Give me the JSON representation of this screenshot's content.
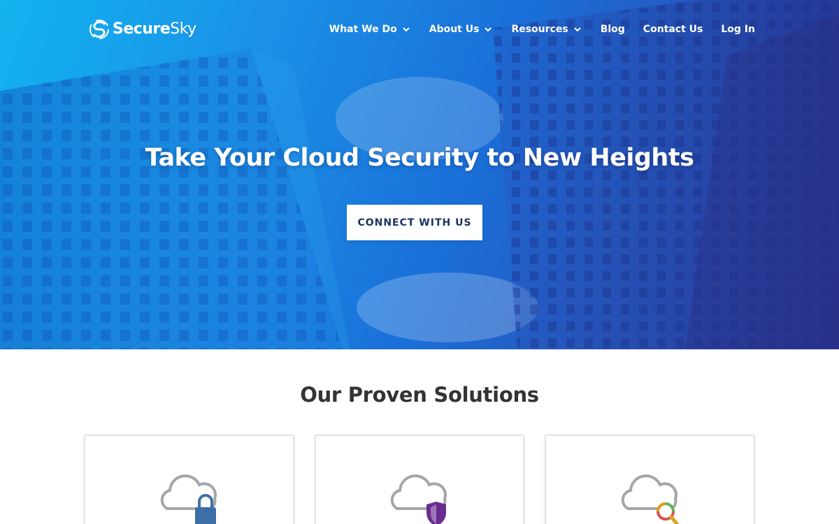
{
  "brand": {
    "name_bold": "Secure",
    "name_light": "Sky",
    "logo_icon": "securesky-s-logo-icon"
  },
  "nav": {
    "items": [
      {
        "label": "What We Do",
        "has_dropdown": true
      },
      {
        "label": "About Us",
        "has_dropdown": true
      },
      {
        "label": "Resources",
        "has_dropdown": true
      },
      {
        "label": "Blog",
        "has_dropdown": false
      },
      {
        "label": "Contact Us",
        "has_dropdown": false
      },
      {
        "label": "Log In",
        "has_dropdown": false
      }
    ]
  },
  "hero": {
    "headline": "Take Your Cloud Security to New Heights",
    "cta_label": "CONNECT WITH US"
  },
  "solutions": {
    "title": "Our Proven Solutions",
    "cards": [
      {
        "icon": "cloud-lock-icon",
        "accent": "#3c6fa8"
      },
      {
        "icon": "cloud-shield-icon",
        "accent": "#6a2c8f"
      },
      {
        "icon": "cloud-search-icon",
        "accent": "#e0a020"
      }
    ]
  },
  "colors": {
    "hero_start": "#12b3ef",
    "hero_end": "#31399c",
    "cta_text": "#1b3360",
    "heading": "#333333"
  }
}
